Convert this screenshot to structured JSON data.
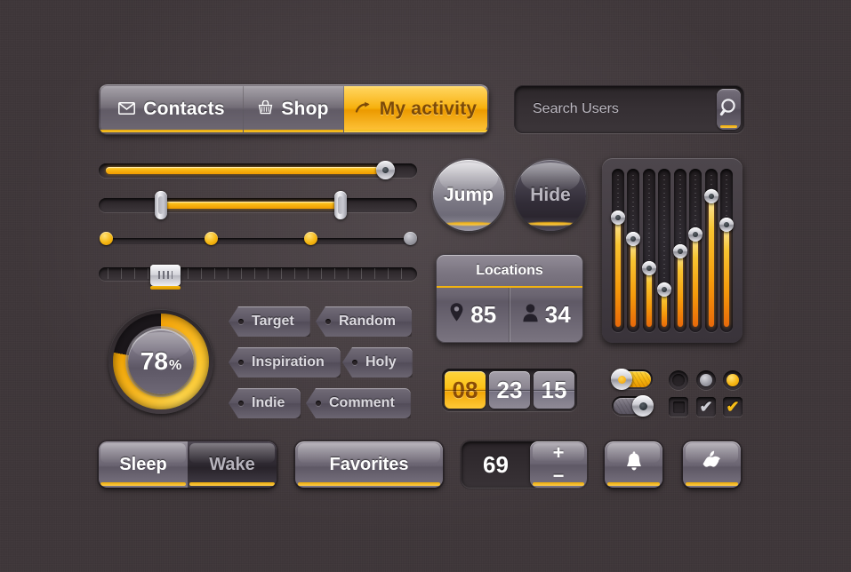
{
  "theme": {
    "background": "#3e3639",
    "accent": "#f6b60f",
    "accent_light": "#ffd63f",
    "panel": "#6a6471",
    "dark": "#2b2529",
    "text": "#ffffff",
    "text_muted": "#b6b3bc"
  },
  "navbar": {
    "tabs": [
      {
        "label": "Contacts",
        "icon": "envelope-icon",
        "state": "inactive"
      },
      {
        "label": "Shop",
        "icon": "basket-icon",
        "state": "inactive"
      },
      {
        "label": "My activity",
        "icon": "arrow-right-icon",
        "state": "active"
      }
    ]
  },
  "search": {
    "placeholder": "Search Users",
    "value": "",
    "button_icon": "search-icon"
  },
  "sliders": {
    "slider1": {
      "name": "single-handle-slider",
      "value": 89,
      "fill_percent": 89
    },
    "slider2": {
      "name": "range-slider",
      "low": 18,
      "high": 76
    },
    "slider3": {
      "name": "step-dot-slider",
      "dots": [
        {
          "position": 0,
          "state": "on"
        },
        {
          "position": 33,
          "state": "on"
        },
        {
          "position": 64,
          "state": "on"
        },
        {
          "position": 96,
          "state": "off"
        }
      ]
    },
    "slider4": {
      "name": "grip-tick-slider",
      "value": 17
    }
  },
  "gauge": {
    "value": 78,
    "unit": "%",
    "label": "progress-gauge"
  },
  "tags": [
    {
      "label": "Target"
    },
    {
      "label": "Random"
    },
    {
      "label": "Inspiration"
    },
    {
      "label": "Holy"
    },
    {
      "label": "Indie"
    },
    {
      "label": "Comment"
    }
  ],
  "round_buttons": [
    {
      "label": "Jump",
      "state": "light"
    },
    {
      "label": "Hide",
      "state": "dark"
    }
  ],
  "locations": {
    "title": "Locations",
    "stats": [
      {
        "icon": "map-pin-icon",
        "value": "85"
      },
      {
        "icon": "person-icon",
        "value": "34"
      }
    ]
  },
  "clock": {
    "digits": [
      {
        "value": "08",
        "state": "on"
      },
      {
        "value": "23",
        "state": "off"
      },
      {
        "value": "15",
        "state": "off"
      }
    ]
  },
  "equalizer": {
    "name": "equalizer-panel",
    "bands": [
      {
        "level": 77
      },
      {
        "level": 62
      },
      {
        "level": 41
      },
      {
        "level": 26
      },
      {
        "level": 53
      },
      {
        "level": 65
      },
      {
        "level": 92
      },
      {
        "level": 72
      }
    ]
  },
  "toggles": [
    {
      "name": "toggle-on",
      "state": "on"
    },
    {
      "name": "toggle-off",
      "state": "off"
    }
  ],
  "radios": [
    {
      "state": "empty"
    },
    {
      "state": "grey"
    },
    {
      "state": "amber"
    }
  ],
  "checkboxes": [
    {
      "state": "empty",
      "glyph": ""
    },
    {
      "state": "grey",
      "glyph": "✔"
    },
    {
      "state": "amber",
      "glyph": "✔"
    }
  ],
  "segmented": {
    "options": [
      {
        "label": "Sleep",
        "state": "selected"
      },
      {
        "label": "Wake",
        "state": "normal"
      }
    ]
  },
  "favorites_button": {
    "label": "Favorites"
  },
  "stepper": {
    "value": "69",
    "plus_label": "+",
    "minus_label": "−"
  },
  "icon_buttons": [
    {
      "name": "bell-button",
      "icon": "bell-icon"
    },
    {
      "name": "apple-button",
      "icon": "apple-icon"
    }
  ]
}
